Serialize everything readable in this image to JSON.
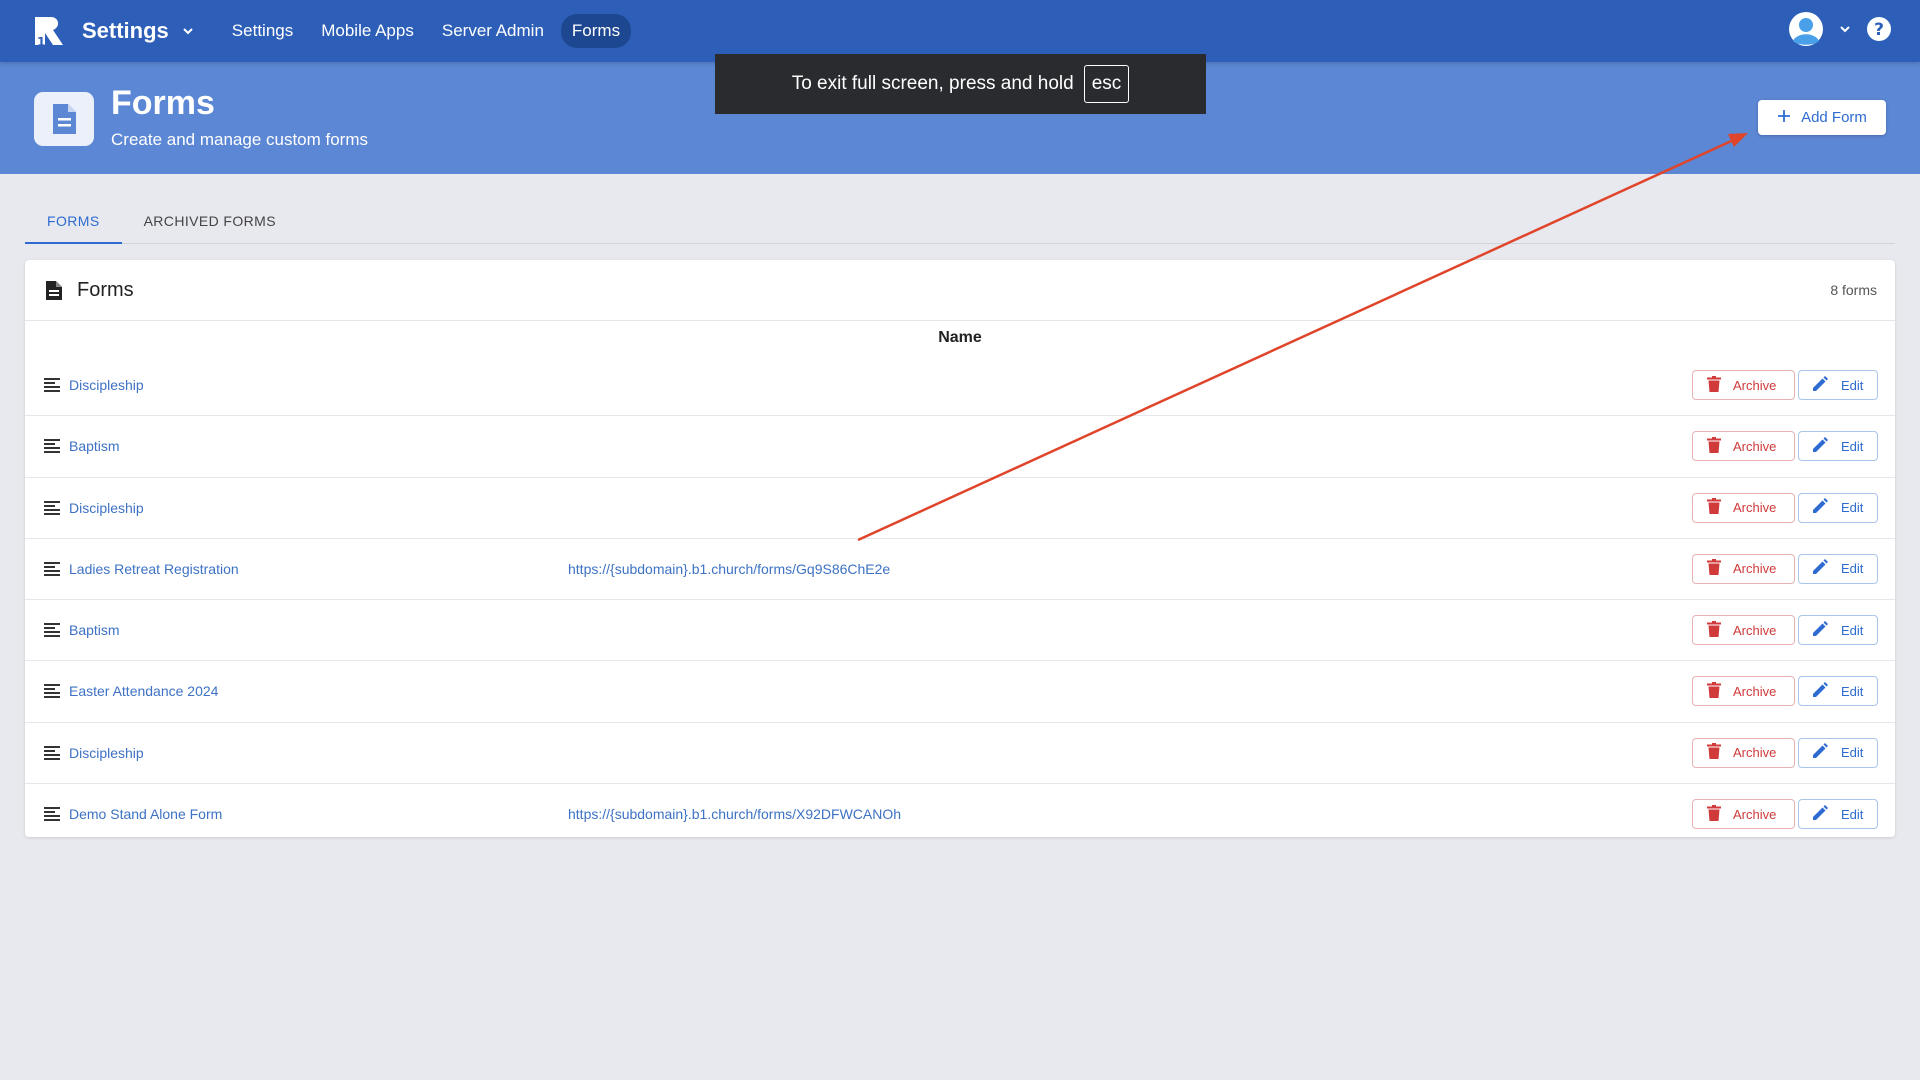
{
  "app": {
    "title": "Settings"
  },
  "nav": [
    {
      "label": "Settings",
      "active": false
    },
    {
      "label": "Mobile Apps",
      "active": false
    },
    {
      "label": "Server Admin",
      "active": false
    },
    {
      "label": "Forms",
      "active": true
    }
  ],
  "fullscreen_toast": {
    "text": "To exit full screen, press and hold",
    "key": "esc"
  },
  "header": {
    "title": "Forms",
    "subtitle": "Create and manage custom forms",
    "add_button": "Add Form"
  },
  "tabs": [
    {
      "label": "FORMS",
      "active": true
    },
    {
      "label": "ARCHIVED FORMS",
      "active": false
    }
  ],
  "card": {
    "title": "Forms",
    "count": "8 forms",
    "column_header": "Name",
    "archive_label": "Archive",
    "edit_label": "Edit",
    "rows": [
      {
        "name": "Discipleship",
        "url": ""
      },
      {
        "name": "Baptism",
        "url": ""
      },
      {
        "name": "Discipleship",
        "url": ""
      },
      {
        "name": "Ladies Retreat Registration",
        "url": "https://{subdomain}.b1.church/forms/Gq9S86ChE2e"
      },
      {
        "name": "Baptism",
        "url": ""
      },
      {
        "name": "Easter Attendance 2024",
        "url": ""
      },
      {
        "name": "Discipleship",
        "url": ""
      },
      {
        "name": "Demo Stand Alone Form",
        "url": "https://{subdomain}.b1.church/forms/X92DFWCANOh"
      }
    ]
  },
  "colors": {
    "nav_bg": "#2d5fb8",
    "header_bg": "#5b87d4",
    "link": "#3d72c4",
    "archive": "#d03a3a",
    "edit": "#2d6bd0",
    "annotation_arrow": "#e0452b"
  },
  "icons": {
    "logo": "b1-logo-icon",
    "user": "user-avatar-icon",
    "help": "help-icon",
    "form": "document-icon",
    "row": "lines-icon",
    "archive": "trash-icon",
    "edit": "pencil-icon",
    "add": "plus-icon"
  }
}
